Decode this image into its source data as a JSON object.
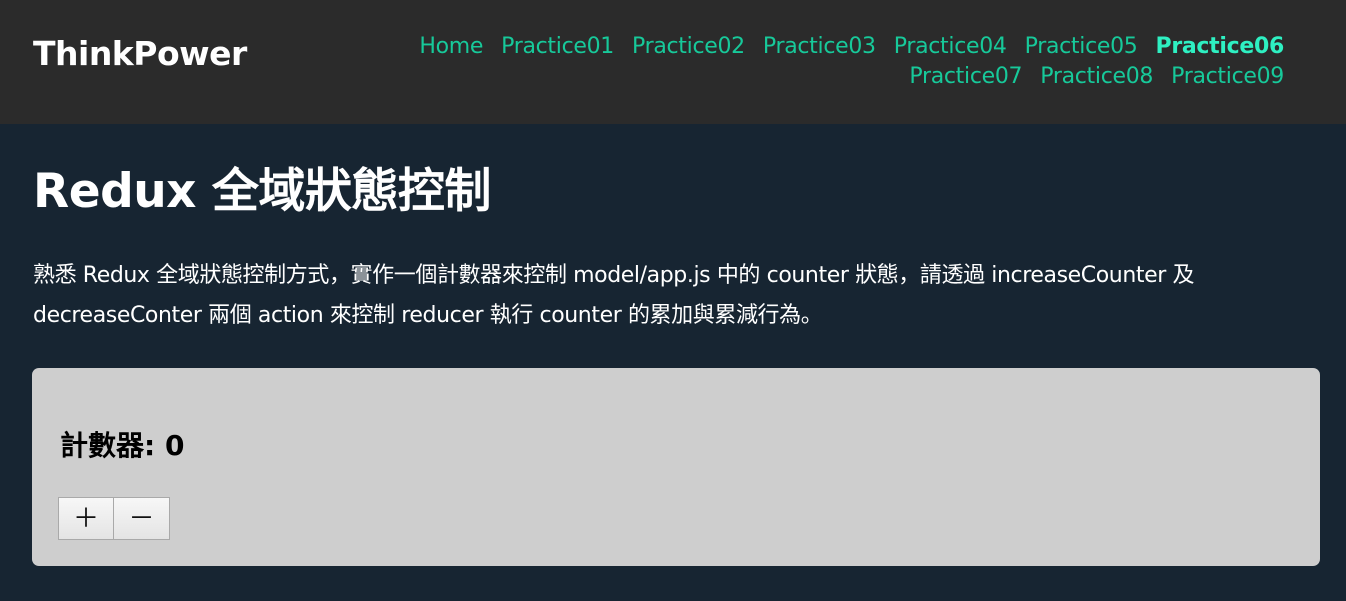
{
  "navbar": {
    "brand": "ThinkPower",
    "links": [
      {
        "label": "Home",
        "active": false
      },
      {
        "label": "Practice01",
        "active": false
      },
      {
        "label": "Practice02",
        "active": false
      },
      {
        "label": "Practice03",
        "active": false
      },
      {
        "label": "Practice04",
        "active": false
      },
      {
        "label": "Practice05",
        "active": false
      },
      {
        "label": "Practice06",
        "active": true
      },
      {
        "label": "Practice07",
        "active": false
      },
      {
        "label": "Practice08",
        "active": false
      },
      {
        "label": "Practice09",
        "active": false
      }
    ]
  },
  "main": {
    "title": "Redux 全域狀態控制",
    "description": "熟悉 Redux 全域狀態控制方式，實作一個計數器來控制 model/app.js 中的 counter 狀態，請透過 increaseCounter 及 decreaseConter 兩個 action 來控制 reducer 執行 counter 的累加與累減行為。"
  },
  "counter": {
    "label": "計數器: 0",
    "increase_label": "＋",
    "decrease_label": "－"
  },
  "colors": {
    "navbar_bg": "#2b2b2b",
    "page_bg": "#172532",
    "link": "#17c99a",
    "link_active": "#2ef0c2",
    "panel_bg": "#cecece"
  }
}
